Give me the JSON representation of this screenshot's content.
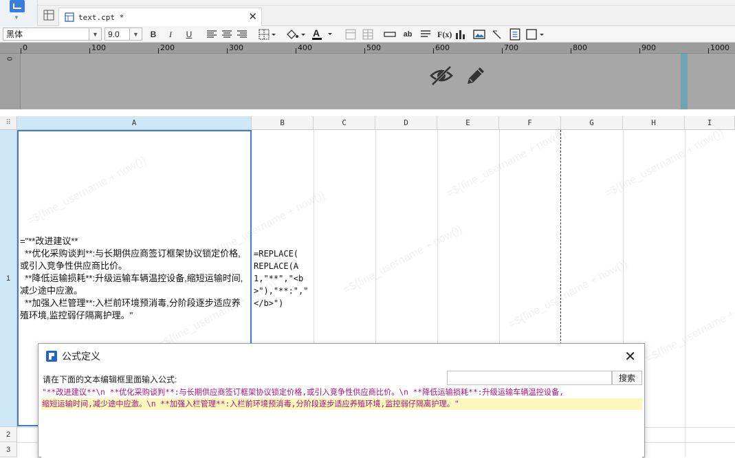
{
  "tab": {
    "title": "text.cpt *"
  },
  "toolbar": {
    "font": "黑体",
    "size": "9.0",
    "bold": "B",
    "italic": "I",
    "underline": "U",
    "ab_label": "ab",
    "fx_label": "F(x)"
  },
  "ruler": {
    "ticks": [
      "0",
      "100",
      "200",
      "300",
      "400",
      "500",
      "600",
      "700",
      "800",
      "900",
      "1000"
    ],
    "v_tick": "0"
  },
  "sheet": {
    "columns": [
      "A",
      "B",
      "C",
      "D",
      "E",
      "F",
      "G",
      "H",
      "I"
    ],
    "rows": [
      "1",
      "2",
      "3"
    ],
    "cellA": "=\"**改进建议**\n  **优化采购谈判**:与长期供应商签订框架协议锁定价格,或引入竞争性供应商比价。\n  **降低运输损耗**:升级运输车辆温控设备,缩短运输时间,减少途中应激。\n  **加强入栏管理**:入栏前环境预消毒,分阶段逐步适应养殖环境,监控弱仔隔离护理。\"",
    "cellB": "=REPLACE(\nREPLACE(A\n1,\"**\",\"<b\n>\"),\"**:\",\"\n</b>\")",
    "watermark": "=${fine_username + now()}"
  },
  "dialog": {
    "title": "公式定义",
    "prompt": "请在下面的文本编辑框里面输入公式:",
    "search_button": "搜索",
    "search_value": "",
    "editor_line1": "\"**改进建议**\\n **优化采购谈判**:与长期供应商签订框架协议锁定价格,或引入竞争性供应商比价。\\n **降低运输损耗**:升级运输车辆温控设备,",
    "editor_line2": "缩短运输时间,减少途中应激。\\n **加强入栏管理**:入栏前环境预消毒,分阶段逐步适应养殖环境,监控弱仔隔离护理。\""
  }
}
